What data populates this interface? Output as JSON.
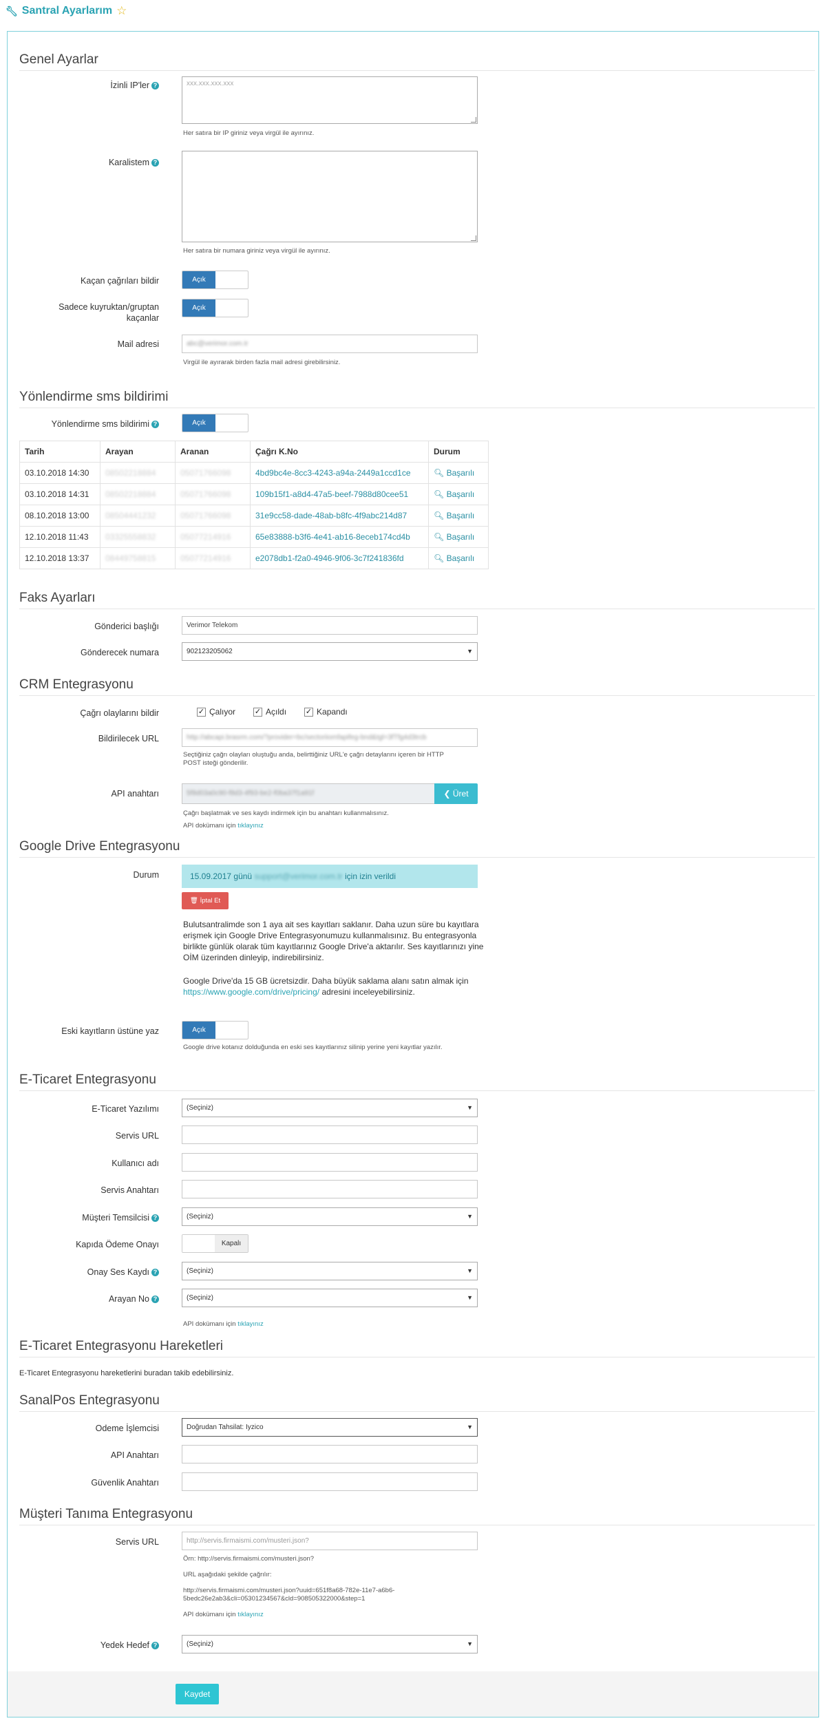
{
  "page": {
    "title": "Santral Ayarlarım"
  },
  "genel": {
    "title": "Genel Ayarlar",
    "izinli_ip_label": "İzinli IP'ler",
    "izinli_ip_placeholder": "xxx.xxx.xxx.xxx",
    "izinli_ip_help": "Her satıra bir IP giriniz veya virgül ile ayırınız.",
    "karaliste_label": "Karalistem",
    "karaliste_help": "Her satıra bir numara giriniz veya virgül ile ayırınız.",
    "kacan_label": "Kaçan çağrıları bildir",
    "kacan_on": "Açık",
    "sadece_label_1": "Sadece kuyruktan/gruptan",
    "sadece_label_2": "kaçanlar",
    "sadece_on": "Açık",
    "mail_label": "Mail adresi",
    "mail_value": "abc@verimor.com.tr",
    "mail_help": "Virgül ile ayırarak birden fazla mail adresi girebilirsiniz."
  },
  "sms": {
    "title": "Yönlendirme sms bildirimi",
    "toggle_label": "Yönlendirme sms bildirimi",
    "toggle_on": "Açık",
    "columns": [
      "Tarih",
      "Arayan",
      "Aranan",
      "Çağrı K.No",
      "Durum"
    ],
    "rows": [
      {
        "tarih": "03.10.2018 14:30",
        "arayan": "08502218884",
        "aranan": "05071766098",
        "id": "4bd9bc4e-8cc3-4243-a94a-2449a1ccd1ce",
        "durum": "Başarılı"
      },
      {
        "tarih": "03.10.2018 14:31",
        "arayan": "08502218884",
        "aranan": "05071766098",
        "id": "109b15f1-a8d4-47a5-beef-7988d80cee51",
        "durum": "Başarılı"
      },
      {
        "tarih": "08.10.2018 13:00",
        "arayan": "08504441232",
        "aranan": "05071766098",
        "id": "31e9cc58-dade-48ab-b8fc-4f9abc214d87",
        "durum": "Başarılı"
      },
      {
        "tarih": "12.10.2018 11:43",
        "arayan": "03325558832",
        "aranan": "05077214916",
        "id": "65e83888-b3f6-4e41-ab16-8eceb174cd4b",
        "durum": "Başarılı"
      },
      {
        "tarih": "12.10.2018 13:37",
        "arayan": "08449758815",
        "aranan": "05077214916",
        "id": "e2078db1-f2a0-4946-9f06-3c7f241836fd",
        "durum": "Başarılı"
      }
    ]
  },
  "faks": {
    "title": "Faks Ayarları",
    "gonderici_label": "Gönderici başlığı",
    "gonderici_value": "Verimor Telekom",
    "numara_label": "Gönderecek numara",
    "numara_value": "902123205062"
  },
  "crm": {
    "title": "CRM Entegrasyonu",
    "olay_label": "Çağrı olaylarını bildir",
    "check_1": "Çalıyor",
    "check_2": "Açıldı",
    "check_3": "Kapandı",
    "url_label": "Bildirilecek URL",
    "url_value": "http://abcapi.brasrm.com/?provider=bc/sectoriiomfapifeg-bnd&tgl=3fTfg4d3trcb",
    "url_help_1": "Seçtiğiniz çağrı olayları oluştuğu anda, belirttiğiniz URL'e çağrı detaylarını içeren bir HTTP",
    "url_help_2": "POST isteği gönderilir.",
    "api_label": "API anahtarı",
    "api_value": "5f8d03a0c90-f8d3-4f93-be2-f0ba37f1a91f",
    "uret_button": "Üret",
    "api_help": "Çağrı başlatmak ve ses kaydı indirmek için bu anahtarı kullanmalısınız.",
    "doc_text": "API dokümanı için",
    "doc_link": "tıklayınız"
  },
  "gdrive": {
    "title": "Google Drive Entegrasyonu",
    "durum_label": "Durum",
    "status_date": "15.09.2017 günü",
    "status_email": "support@verimor.com.tr",
    "status_suffix": "için izin verildi",
    "iptal_button": "İptal Et",
    "para1": "Bulutsantralimde son 1 aya ait ses kayıtları saklanır. Daha uzun süre bu kayıtlara erişmek için Google Drive Entegrasyonumuzu kullanmalısınız. Bu entegrasyonla birlikte günlük olarak tüm kayıtlarınız Google Drive'a aktarılır. Ses kayıtlarınızı yine OİM üzerinden dinleyip, indirebilirsiniz.",
    "para2_prefix": "Google Drive'da 15 GB ücretsizdir. Daha büyük saklama alanı satın almak için",
    "para2_link": "https://www.google.com/drive/pricing/",
    "para2_suffix": "adresini inceleyebilirsiniz.",
    "eski_label": "Eski kayıtların üstüne yaz",
    "eski_on": "Açık",
    "eski_help": "Google drive kotanız dolduğunda en eski ses kayıtlarınız silinip yerine yeni kayıtlar yazılır."
  },
  "eticaret": {
    "title": "E-Ticaret Entegrasyonu",
    "yazilim_label": "E-Ticaret Yazılımı",
    "yazilim_value": "(Seçiniz)",
    "servis_url_label": "Servis URL",
    "kullanici_label": "Kullanıcı adı",
    "anahtar_label": "Servis Anahtarı",
    "temsilci_label": "Müşteri Temsilcisi",
    "temsilci_value": "(Seçiniz)",
    "kapida_label": "Kapıda Ödeme Onayı",
    "kapida_off": "Kapalı",
    "onay_label": "Onay Ses Kaydı",
    "onay_value": "(Seçiniz)",
    "arayan_label": "Arayan No",
    "arayan_value": "(Seçiniz)",
    "doc_text": "API dokümanı için",
    "doc_link": "tıklayınız"
  },
  "hareketler": {
    "title": "E-Ticaret Entegrasyonu Hareketleri",
    "text": "E-Ticaret Entegrasyonu hareketlerini buradan takib edebilirsiniz."
  },
  "sanalpos": {
    "title": "SanalPos Entegrasyonu",
    "odeme_label": "Odeme İşlemcisi",
    "odeme_value": "Doğrudan Tahsilat: Iyzico",
    "api_label": "API Anahtarı",
    "guvenlik_label": "Güvenlik Anahtarı"
  },
  "musteri": {
    "title": "Müşteri Tanıma Entegrasyonu",
    "servis_label": "Servis URL",
    "servis_placeholder": "http://servis.firmaismi.com/musteri.json?",
    "ornek": "Örn: http://servis.firmaismi.com/musteri.json?",
    "url_text": "URL aşağıdaki şekilde çağrılır:",
    "url_example_1": "http://servis.firmaismi.com/musteri.json?uuid=651f8a68-782e-11e7-a6b6-",
    "url_example_2": "5bedc26e2ab3&cli=05301234567&cld=908505322000&step=1",
    "doc_text": "API dokümanı için",
    "doc_link": "tıklayınız",
    "yedek_label": "Yedek Hedef",
    "yedek_value": "(Seçiniz)"
  },
  "footer": {
    "save_button": "Kaydet"
  },
  "colors": {
    "accent": "#2aa3b3",
    "primary_toggle": "#337ab7",
    "danger": "#e05a55",
    "info_bg": "#b2e6ec"
  }
}
